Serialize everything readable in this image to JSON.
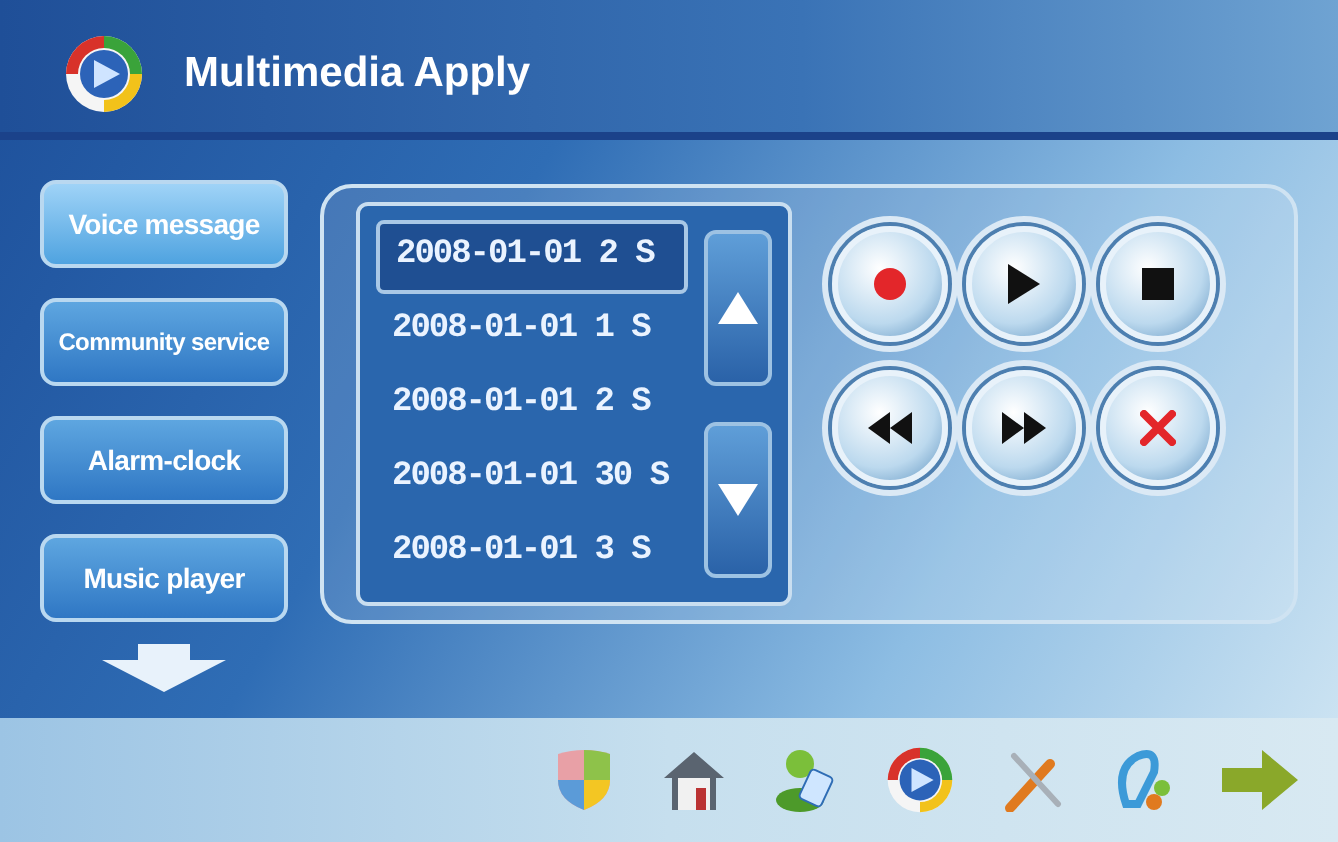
{
  "window": {
    "title": "Multimedia Apply"
  },
  "menu": [
    {
      "label": "Voice message",
      "selected": true
    },
    {
      "label": "Community service",
      "selected": false
    },
    {
      "label": "Alarm-clock",
      "selected": false
    },
    {
      "label": "Music player",
      "selected": false
    }
  ],
  "recordings": [
    {
      "label": "2008-01-01 2 S",
      "selected": true
    },
    {
      "label": "2008-01-01 1 S",
      "selected": false
    },
    {
      "label": "2008-01-01 2 S",
      "selected": false
    },
    {
      "label": "2008-01-01 30 S",
      "selected": false
    },
    {
      "label": "2008-01-01 3 S",
      "selected": false
    }
  ]
}
